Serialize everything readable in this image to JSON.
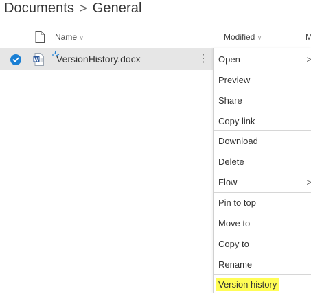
{
  "breadcrumb": {
    "parent": "Documents",
    "separator": ">",
    "current": "General"
  },
  "columns": {
    "name": "Name",
    "modified": "Modified",
    "next_truncated": "M",
    "sort_chevron": "∨"
  },
  "file": {
    "name": "VersionHistory.docx",
    "selected": true,
    "more_actions": "⋮",
    "icon": "word-doc-icon"
  },
  "context_menu": {
    "items": [
      {
        "label": "Open",
        "submenu": true
      },
      {
        "label": "Preview"
      },
      {
        "label": "Share"
      },
      {
        "label": "Copy link"
      },
      {
        "label": "Download"
      },
      {
        "label": "Delete"
      },
      {
        "label": "Flow",
        "submenu": true
      },
      {
        "label": "Pin to top"
      },
      {
        "label": "Move to"
      },
      {
        "label": "Copy to"
      },
      {
        "label": "Rename"
      },
      {
        "label": "Version history",
        "highlighted": true
      }
    ],
    "submenu_arrow": ">"
  },
  "colors": {
    "accent": "#1a7fd4",
    "selected_row": "#e6e6e6",
    "highlight": "#fffd55",
    "word_blue": "#2b579a"
  }
}
